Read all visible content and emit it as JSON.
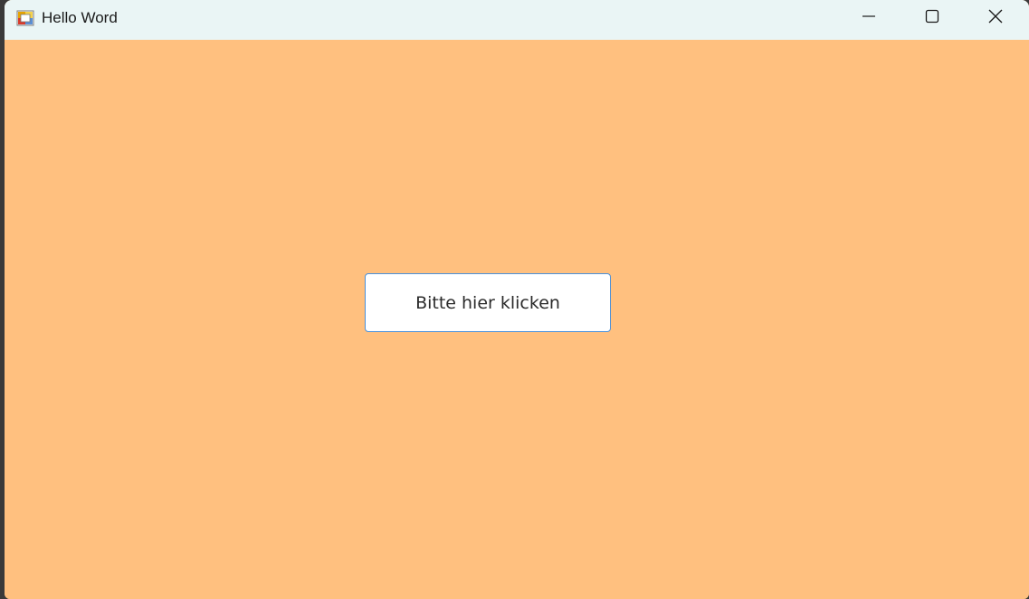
{
  "window": {
    "title": "Hello Word",
    "icon": "winforms-app-icon",
    "background_color": "#ffc07f",
    "titlebar_color": "#eaf5f5",
    "controls": {
      "minimize_icon": "minimize-icon",
      "maximize_icon": "maximize-icon",
      "close_icon": "close-icon"
    }
  },
  "main": {
    "button_label": "Bitte hier klicken",
    "button_border_color": "#4a90d9"
  }
}
